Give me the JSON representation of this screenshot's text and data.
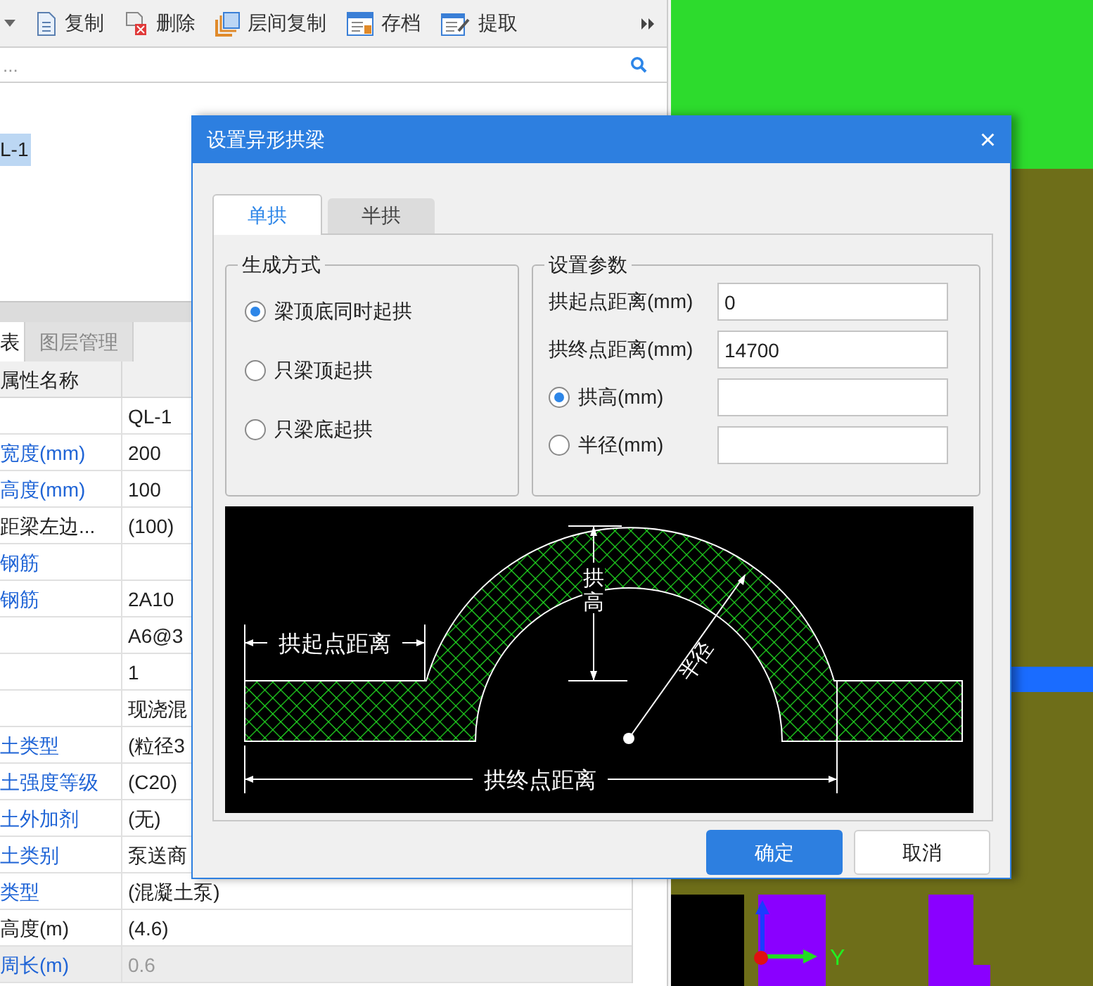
{
  "toolbar": {
    "items": [
      {
        "kind": "copy",
        "label": "复制"
      },
      {
        "kind": "delete",
        "label": "删除"
      },
      {
        "kind": "floor-copy",
        "label": "层间复制"
      },
      {
        "kind": "archive",
        "label": "存档"
      },
      {
        "kind": "extract",
        "label": "提取"
      }
    ]
  },
  "search": {
    "placeholder": "..."
  },
  "tree": {
    "items": [
      {
        "label": "L-1",
        "selected": true
      }
    ]
  },
  "bottom_tabs": [
    {
      "label": "表",
      "selected": true
    },
    {
      "label": "图层管理",
      "selected": false
    }
  ],
  "properties": {
    "columns": [
      "属性名称"
    ],
    "rows": [
      {
        "name": "",
        "value": "QL-1",
        "disabled": false
      },
      {
        "name": "宽度(mm)",
        "value": "200",
        "linked": true,
        "disabled": false
      },
      {
        "name": "高度(mm)",
        "value": "100",
        "linked": true,
        "disabled": false
      },
      {
        "name": "距梁左边...",
        "value": "(100)",
        "linked": false,
        "disabled": false
      },
      {
        "name": "钢筋",
        "value": "",
        "linked": true,
        "disabled": false
      },
      {
        "name": "钢筋",
        "value": "2A10",
        "linked": true,
        "disabled": false
      },
      {
        "name": "",
        "value": "A6@3",
        "disabled": false
      },
      {
        "name": "",
        "value": "1",
        "disabled": false
      },
      {
        "name": "",
        "value": "现浇混",
        "disabled": false
      },
      {
        "name": "土类型",
        "value": "(粒径3",
        "linked": true,
        "disabled": false
      },
      {
        "name": "土强度等级",
        "value": "(C20)",
        "linked": true,
        "disabled": false
      },
      {
        "name": "土外加剂",
        "value": "(无)",
        "linked": true,
        "disabled": false
      },
      {
        "name": "土类别",
        "value": "泵送商",
        "linked": true,
        "disabled": false
      },
      {
        "name": "类型",
        "value": "(混凝土泵)",
        "linked": true,
        "disabled": false
      },
      {
        "name": "高度(m)",
        "value": "(4.6)",
        "linked": false,
        "disabled": false
      },
      {
        "name": "周长(m)",
        "value": "0.6",
        "linked": true,
        "disabled": true
      }
    ]
  },
  "viewport": {
    "axis_label": "Y"
  },
  "dialog": {
    "title": "设置异形拱梁",
    "close": "×",
    "tabs": [
      {
        "label": "单拱",
        "selected": true
      },
      {
        "label": "半拱",
        "selected": false
      }
    ],
    "method_group": {
      "title": "生成方式",
      "options": [
        {
          "label": "梁顶底同时起拱",
          "selected": true
        },
        {
          "label": "只梁顶起拱",
          "selected": false
        },
        {
          "label": "只梁底起拱",
          "selected": false
        }
      ]
    },
    "param_group": {
      "title": "设置参数",
      "rows": [
        {
          "kind": "field",
          "label": "拱起点距离(mm)",
          "value": "0"
        },
        {
          "kind": "field",
          "label": "拱终点距离(mm)",
          "value": "14700"
        },
        {
          "kind": "radio",
          "label": "拱高(mm)",
          "value": "",
          "selected": true
        },
        {
          "kind": "radio",
          "label": "半径(mm)",
          "value": "",
          "selected": false
        }
      ]
    },
    "diagram": {
      "start_label": "拱起点距离",
      "end_label": "拱终点距离",
      "height_label": "拱高",
      "radius_label": "半径"
    },
    "buttons": [
      {
        "kind": "primary",
        "label": "确定"
      },
      {
        "kind": "secondary",
        "label": "取消"
      }
    ]
  }
}
